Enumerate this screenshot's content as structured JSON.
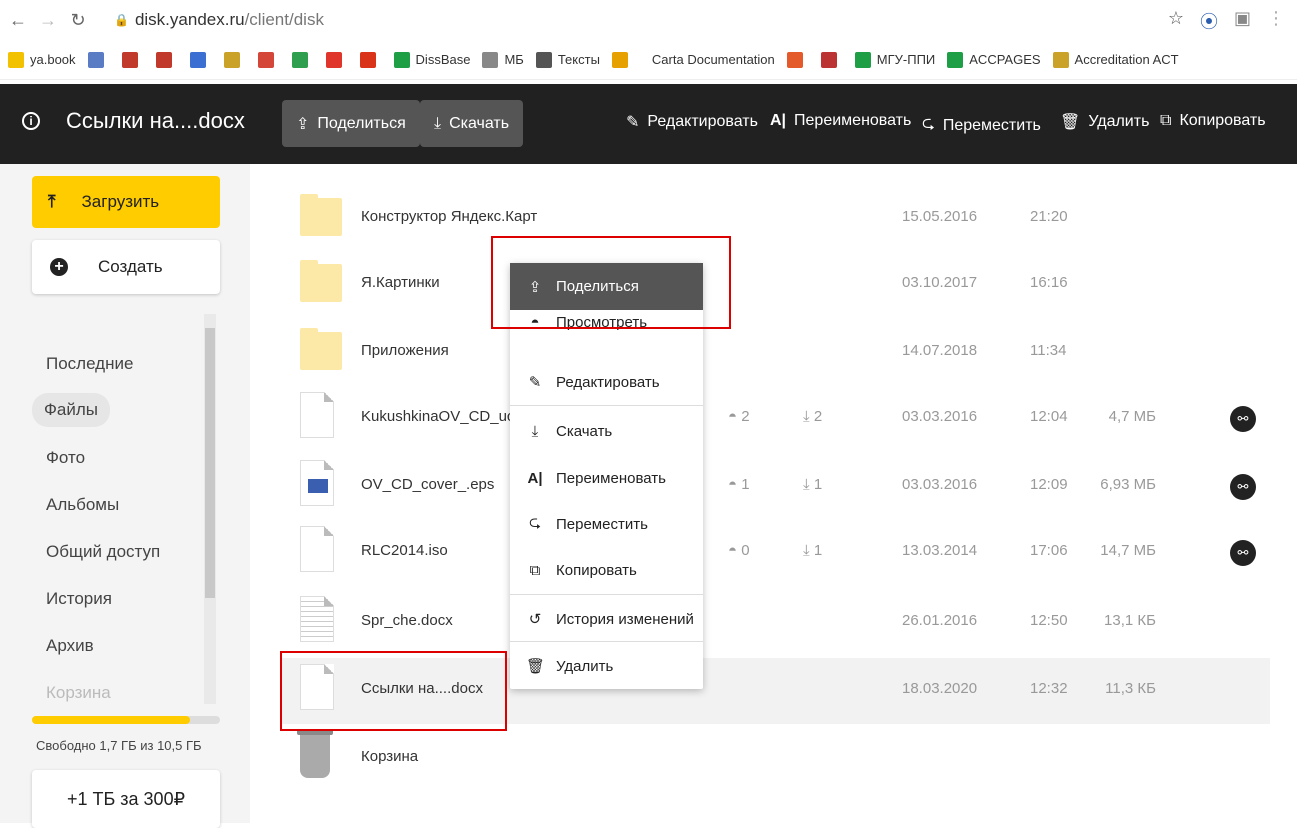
{
  "browser": {
    "url_host": "disk.yandex.ru",
    "url_path": "/client/disk"
  },
  "bookmarks": [
    {
      "label": "ya.book",
      "color": "#f2c200"
    },
    {
      "label": "",
      "color": "#5a7cc4"
    },
    {
      "label": "",
      "color": "#c0392b"
    },
    {
      "label": "",
      "color": "#c0392b"
    },
    {
      "label": "",
      "color": "#3b6fd1"
    },
    {
      "label": "",
      "color": "#c9a227"
    },
    {
      "label": "",
      "color": "#d44638"
    },
    {
      "label": "",
      "color": "#2e9e4f"
    },
    {
      "label": "",
      "color": "#e0352b"
    },
    {
      "label": "",
      "color": "#d9341a"
    },
    {
      "label": "DissBase",
      "color": "#1e9e45"
    },
    {
      "label": "МБ",
      "color": "#888888"
    },
    {
      "label": "Тексты",
      "color": "#555555"
    },
    {
      "label": "",
      "color": "#e6a100"
    },
    {
      "label": "Carta Documentation",
      "color": "#ffffff"
    },
    {
      "label": "",
      "color": "#e45a2a"
    },
    {
      "label": "",
      "color": "#b33"
    },
    {
      "label": "МГУ-ППИ",
      "color": "#1e9e45"
    },
    {
      "label": "ACCPAGES",
      "color": "#1e9e45"
    },
    {
      "label": "Accreditation ACT",
      "color": "#c9a227"
    }
  ],
  "toolbar": {
    "file_name": "Ссылки на....docx",
    "share": "Поделиться",
    "download": "Скачать",
    "edit": "Редактировать",
    "rename": "Переименовать",
    "move": "Переместить",
    "delete": "Удалить",
    "copy": "Копировать"
  },
  "sidebar": {
    "upload": "Загрузить",
    "create": "Создать",
    "items": [
      "Последние",
      "Файлы",
      "Фото",
      "Альбомы",
      "Общий доступ",
      "История",
      "Архив",
      "Корзина"
    ],
    "active": "Файлы",
    "free_space": "Свободно 1,7 ГБ из 10,5 ГБ",
    "quota_used": 0.84,
    "buy": "+1 ТБ за 300₽"
  },
  "files": [
    {
      "type": "folder",
      "name": "Конструктор Яндекс.Карт",
      "views": "",
      "downloads": "",
      "date": "15.05.2016",
      "time": "21:20",
      "size": "",
      "link": false
    },
    {
      "type": "folder",
      "name": "Я.Картинки",
      "views": "",
      "downloads": "",
      "date": "03.10.2017",
      "time": "16:16",
      "size": "",
      "link": false
    },
    {
      "type": "folder",
      "name": "Приложения",
      "views": "",
      "downloads": "",
      "date": "14.07.2018",
      "time": "11:34",
      "size": "",
      "link": false
    },
    {
      "type": "doc",
      "name": "KukushkinaOV_CD_uchet",
      "views": "2",
      "downloads": "2",
      "date": "03.03.2016",
      "time": "12:04",
      "size": "4,7 МБ",
      "link": true
    },
    {
      "type": "image",
      "name": "OV_CD_cover_.eps",
      "views": "1",
      "downloads": "1",
      "date": "03.03.2016",
      "time": "12:09",
      "size": "6,93 МБ",
      "link": true
    },
    {
      "type": "doc",
      "name": "RLC2014.iso",
      "views": "0",
      "downloads": "1",
      "date": "13.03.2014",
      "time": "17:06",
      "size": "14,7 МБ",
      "link": true
    },
    {
      "type": "docx",
      "name": "Spr_che.docx",
      "views": "",
      "downloads": "",
      "date": "26.01.2016",
      "time": "12:50",
      "size": "13,1 КБ",
      "link": false
    },
    {
      "type": "doc",
      "name": "Ссылки на....docx",
      "views": "",
      "downloads": "",
      "date": "18.03.2020",
      "time": "12:32",
      "size": "11,3 КБ",
      "link": false,
      "selected": true
    },
    {
      "type": "trash",
      "name": "Корзина",
      "views": "",
      "downloads": "",
      "date": "",
      "time": "",
      "size": "",
      "link": false
    }
  ],
  "context_menu": {
    "share": "Поделиться",
    "view": "Просмотреть",
    "edit": "Редактировать",
    "download": "Скачать",
    "rename": "Переименовать",
    "move": "Переместить",
    "copy": "Копировать",
    "history": "История изменений",
    "delete": "Удалить"
  },
  "colors": {
    "toolbar_bg": "#212121",
    "accent_yellow": "#ffcc00",
    "highlight_box": "#dd0000"
  }
}
